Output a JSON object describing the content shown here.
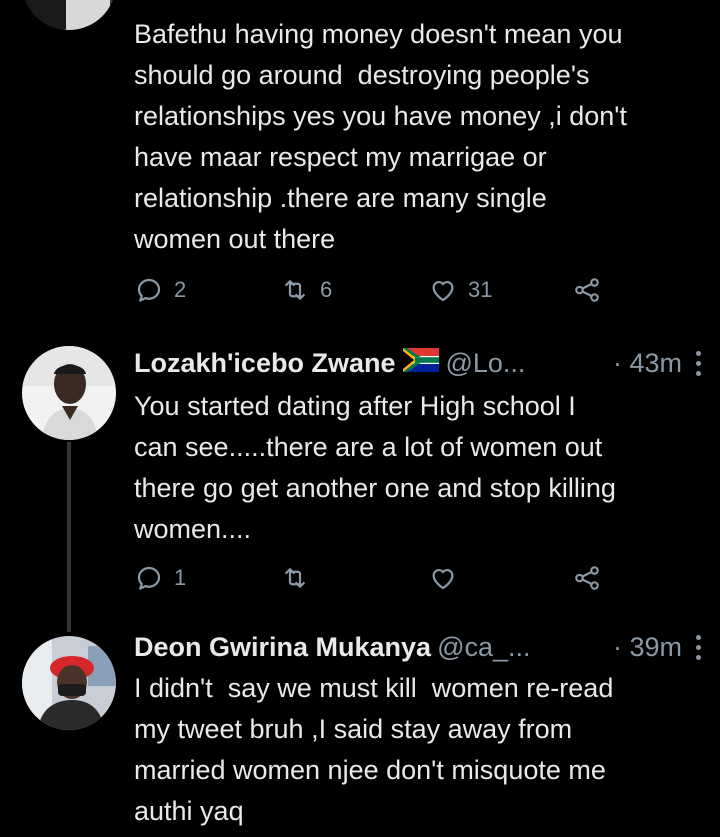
{
  "tweets": [
    {
      "text_lines": [
        "Bafethu having money doesn't mean you",
        "should go around  destroying people's",
        "relationships yes you have money ,i don't",
        "have maar respect my marrigae or",
        "relationship .there are many single",
        "women out there"
      ],
      "replies": "2",
      "retweets": "6",
      "likes": "31"
    },
    {
      "name": "Lozakh'icebo Zwane",
      "handle": "@Lo...",
      "time": "· 43m",
      "text_lines": [
        "You started dating after High school I",
        "can see.....there are a lot of women out",
        "there go get another one and stop killing",
        "women...."
      ],
      "replies": "1",
      "retweets": "",
      "likes": ""
    },
    {
      "name": "Deon Gwirina Mukanya",
      "handle": "@ca_...",
      "time": "· 39m",
      "text_lines": [
        "I didn't  say we must kill  women re-read",
        "my tweet bruh ,I said stay away from",
        "married women njee don't misquote me",
        "authi yaq"
      ]
    }
  ],
  "icons": {
    "reply": "reply-icon",
    "retweet": "retweet-icon",
    "like": "heart-icon",
    "share": "share-icon",
    "more": "more-options-icon",
    "flag": "south-africa-flag-icon"
  },
  "colors": {
    "background": "#000000",
    "text": "#e7e9ea",
    "muted": "#8b98a5",
    "thread_line": "#333639"
  }
}
